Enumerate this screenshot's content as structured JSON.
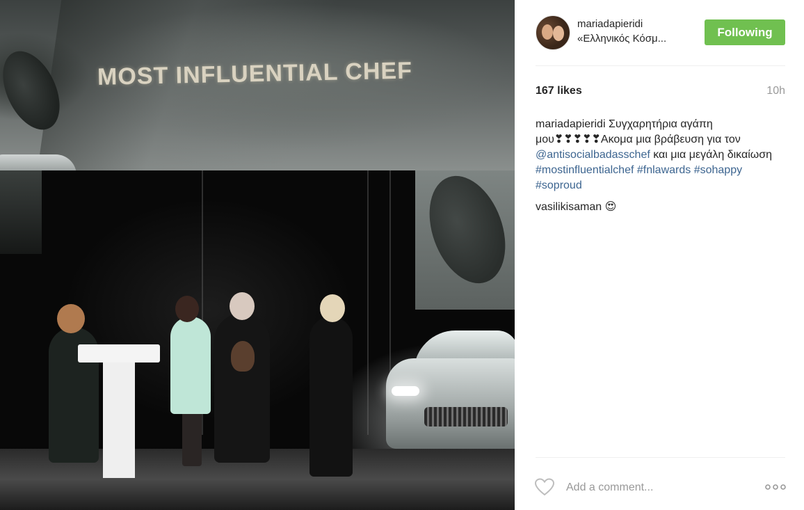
{
  "photo": {
    "headline": "MOST INFLUENTIAL CHEF",
    "alt_icon": "photo"
  },
  "post": {
    "username": "mariadapieridi",
    "location": "«Ελληνικός Κόσμ...",
    "follow_label": "Following",
    "likes": "167 likes",
    "time": "10h",
    "caption": {
      "username": "mariadapieridi",
      "text1": " Συγχαρητήρια αγάπη μου❣❣❣❣❣Ακομα μια βράβευση για τον ",
      "mention": "@antisocialbadasschef",
      "text2": " και μια μεγάλη δικαίωση ",
      "tag1": "#mostinfluentialchef",
      "tag2": "#fnlawards",
      "tag3": "#sohappy",
      "tag4": "#soproud"
    },
    "comment": {
      "username": "vasilikisaman",
      "emoji": "😍"
    },
    "comment_placeholder": "Add a comment...",
    "icons": {
      "like": "heart-icon",
      "more": "more-options-icon"
    }
  },
  "colors": {
    "follow_button": "#70c050",
    "link": "#3d6590",
    "muted": "#999999"
  }
}
